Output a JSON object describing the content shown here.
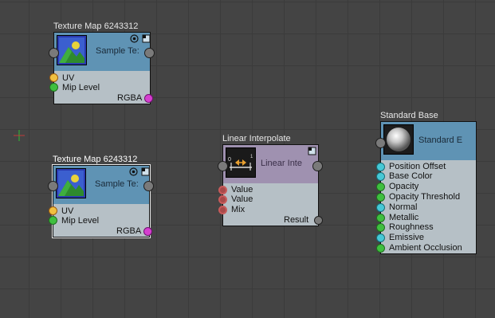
{
  "canvas": {
    "background": "#444444"
  },
  "nodes": {
    "texture1": {
      "title": "Texture Map 6243312",
      "header_label": "Sample Te:",
      "inputs": [
        "UV",
        "Mip Level"
      ],
      "output": "RGBA"
    },
    "texture2": {
      "title": "Texture Map 6243312",
      "header_label": "Sample Te:",
      "inputs": [
        "UV",
        "Mip Level"
      ],
      "output": "RGBA"
    },
    "lerp": {
      "title": "Linear Interpolate",
      "header_label": "Linear Inte",
      "icon_label_left": "0",
      "icon_label_right": "1",
      "inputs": [
        "Value",
        "Value",
        "Mix"
      ],
      "output": "Result"
    },
    "standard": {
      "title": "Standard Base",
      "header_label": "Standard E",
      "inputs": [
        "Position Offset",
        "Base Color",
        "Opacity",
        "Opacity Threshold",
        "Normal",
        "Metallic",
        "Roughness",
        "Emissive",
        "Ambient Occlusion"
      ]
    }
  },
  "colors": {
    "texture_header": "#5f93b4",
    "lerp_header": "#9f91b0",
    "node_body": "#b6c0c6",
    "port_uv": "#f0c040",
    "port_float": "#3fbf3f",
    "port_rgba": "#d63fd0",
    "port_vector": "#46c8d6"
  }
}
